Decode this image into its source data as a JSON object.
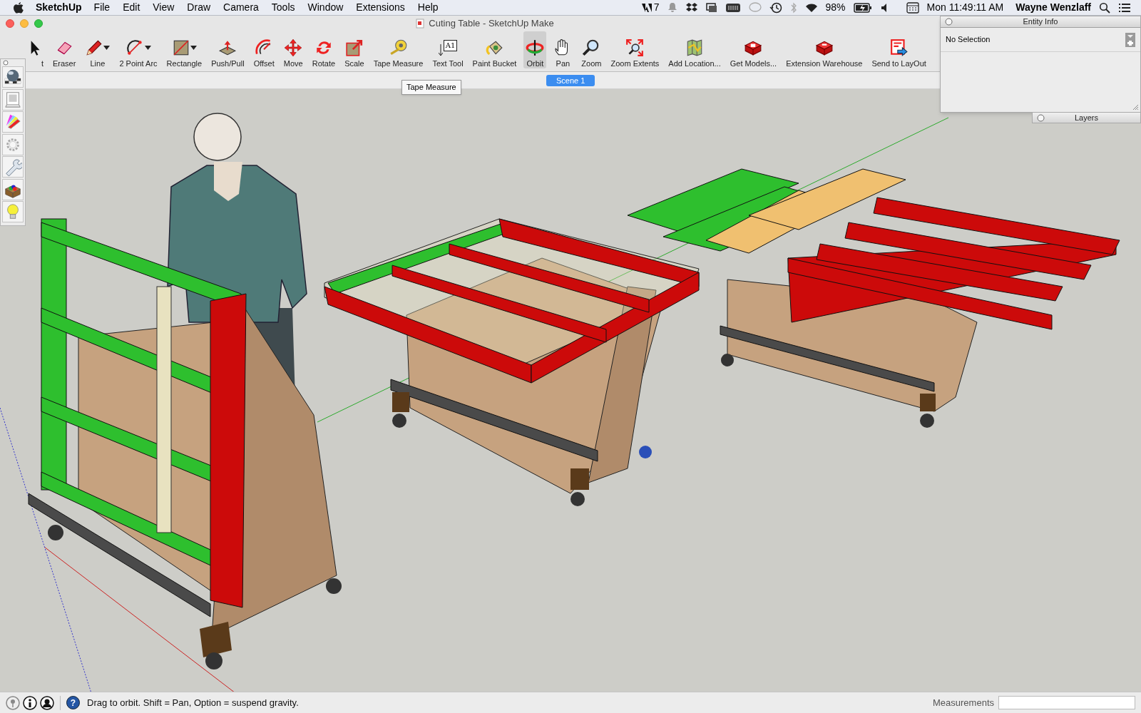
{
  "menu_bar": {
    "app": "SketchUp",
    "items": [
      "File",
      "Edit",
      "View",
      "Draw",
      "Camera",
      "Tools",
      "Window",
      "Extensions",
      "Help"
    ],
    "notification_count": "7",
    "battery": "98%",
    "clock": "Mon 11:49:11 AM",
    "user": "Wayne Wenzlaff"
  },
  "window": {
    "title": "Cuting Table - SketchUp Make"
  },
  "tools": [
    {
      "label": "t",
      "selected": false,
      "dropdown": false
    },
    {
      "label": "Eraser",
      "selected": false,
      "dropdown": false
    },
    {
      "label": "Line",
      "selected": false,
      "dropdown": true
    },
    {
      "label": "2 Point Arc",
      "selected": false,
      "dropdown": true
    },
    {
      "label": "Rectangle",
      "selected": false,
      "dropdown": true
    },
    {
      "label": "Push/Pull",
      "selected": false,
      "dropdown": false
    },
    {
      "label": "Offset",
      "selected": false,
      "dropdown": false
    },
    {
      "label": "Move",
      "selected": false,
      "dropdown": false
    },
    {
      "label": "Rotate",
      "selected": false,
      "dropdown": false
    },
    {
      "label": "Scale",
      "selected": false,
      "dropdown": false
    },
    {
      "label": "Tape Measure",
      "selected": false,
      "dropdown": false
    },
    {
      "label": "Text Tool",
      "selected": false,
      "dropdown": false
    },
    {
      "label": "Paint Bucket",
      "selected": false,
      "dropdown": false
    },
    {
      "label": "Orbit",
      "selected": true,
      "dropdown": false
    },
    {
      "label": "Pan",
      "selected": false,
      "dropdown": false
    },
    {
      "label": "Zoom",
      "selected": false,
      "dropdown": false
    },
    {
      "label": "Zoom Extents",
      "selected": false,
      "dropdown": false
    },
    {
      "label": "Add Location...",
      "selected": false,
      "dropdown": false
    },
    {
      "label": "Get Models...",
      "selected": false,
      "dropdown": false
    },
    {
      "label": "Extension Warehouse",
      "selected": false,
      "dropdown": false
    },
    {
      "label": "Send to LayOut",
      "selected": false,
      "dropdown": false
    }
  ],
  "text_tool_glyph": "A1",
  "scenes": [
    {
      "label": "Scene 1",
      "selected": true
    }
  ],
  "tooltip": "Tape Measure",
  "entity_info": {
    "title": "Entity Info",
    "selection": "No Selection"
  },
  "layers": {
    "title": "Layers"
  },
  "status_bar": {
    "help_glyph": "?",
    "message": "Drag to orbit. Shift = Pan, Option = suspend gravity.",
    "measurements_label": "Measurements"
  }
}
